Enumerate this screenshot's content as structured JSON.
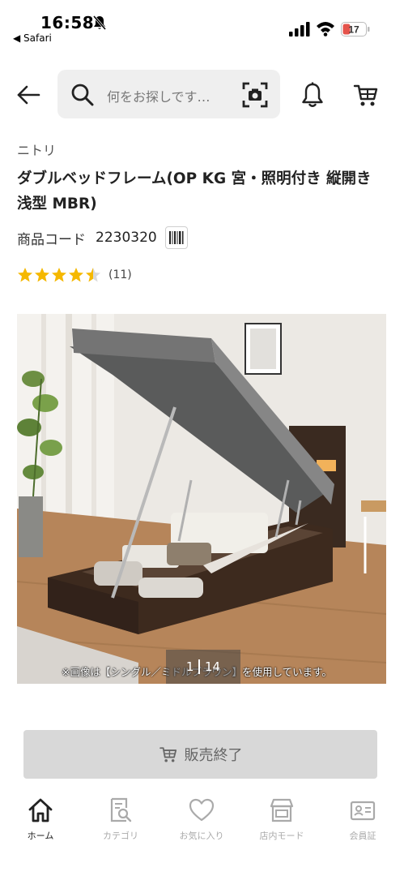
{
  "status_bar": {
    "time": "16:58",
    "back_app": "◀ Safari",
    "battery": "17"
  },
  "header": {
    "search_placeholder": "何をお探しです…"
  },
  "product": {
    "brand": "ニトリ",
    "title": "ダブルベッドフレーム(OP KG 宮・照明付き 縦開き 浅型 MBR)",
    "code_label": "商品コード",
    "code_value": "2230320",
    "rating": 4.5,
    "review_count": "(11)"
  },
  "gallery": {
    "caption": "※画像は【シングル／ミドルブラウン】を使用しています。",
    "current": "1",
    "total": "14"
  },
  "soldout_button": {
    "label": "販売終了"
  },
  "tabbar": {
    "tabs": [
      {
        "label": "ホーム",
        "icon": "home-icon"
      },
      {
        "label": "カテゴリ",
        "icon": "category-search-icon"
      },
      {
        "label": "お気に入り",
        "icon": "heart-icon"
      },
      {
        "label": "店内モード",
        "icon": "store-icon"
      },
      {
        "label": "会員証",
        "icon": "member-card-icon"
      }
    ]
  },
  "colors": {
    "star": "#f5b800",
    "button_bg": "#d8d8d8",
    "battery_red": "#e5534b"
  }
}
